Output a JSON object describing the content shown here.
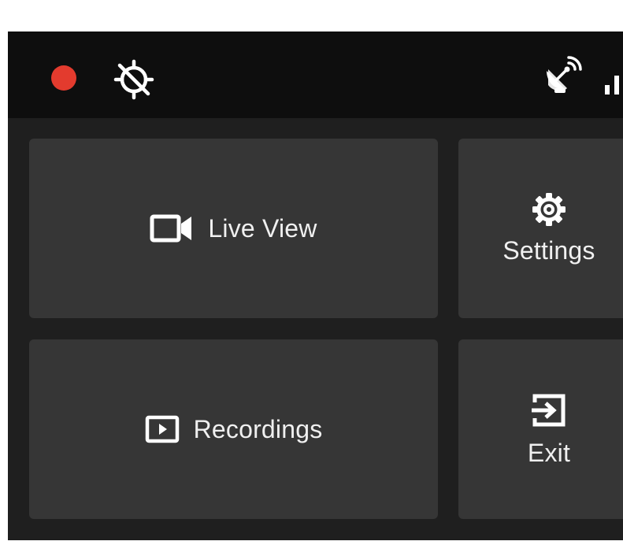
{
  "status_bar": {
    "recording_indicator": "red-dot",
    "recording_color": "#e33b2e",
    "gps_icon": "gps-off-icon",
    "satellite_icon": "satellite-dish-icon",
    "signal_icon": "signal-bars-icon"
  },
  "tiles": {
    "live_view": {
      "label": "Live View",
      "icon": "video-camera-icon"
    },
    "settings": {
      "label": "Settings",
      "icon": "gear-icon"
    },
    "recordings": {
      "label": "Recordings",
      "icon": "play-box-icon"
    },
    "exit": {
      "label": "Exit",
      "icon": "exit-icon"
    }
  },
  "colors": {
    "background": "#1f1f1f",
    "status_bar": "#0e0e0e",
    "tile": "#363636",
    "text": "#f0f0f0"
  }
}
